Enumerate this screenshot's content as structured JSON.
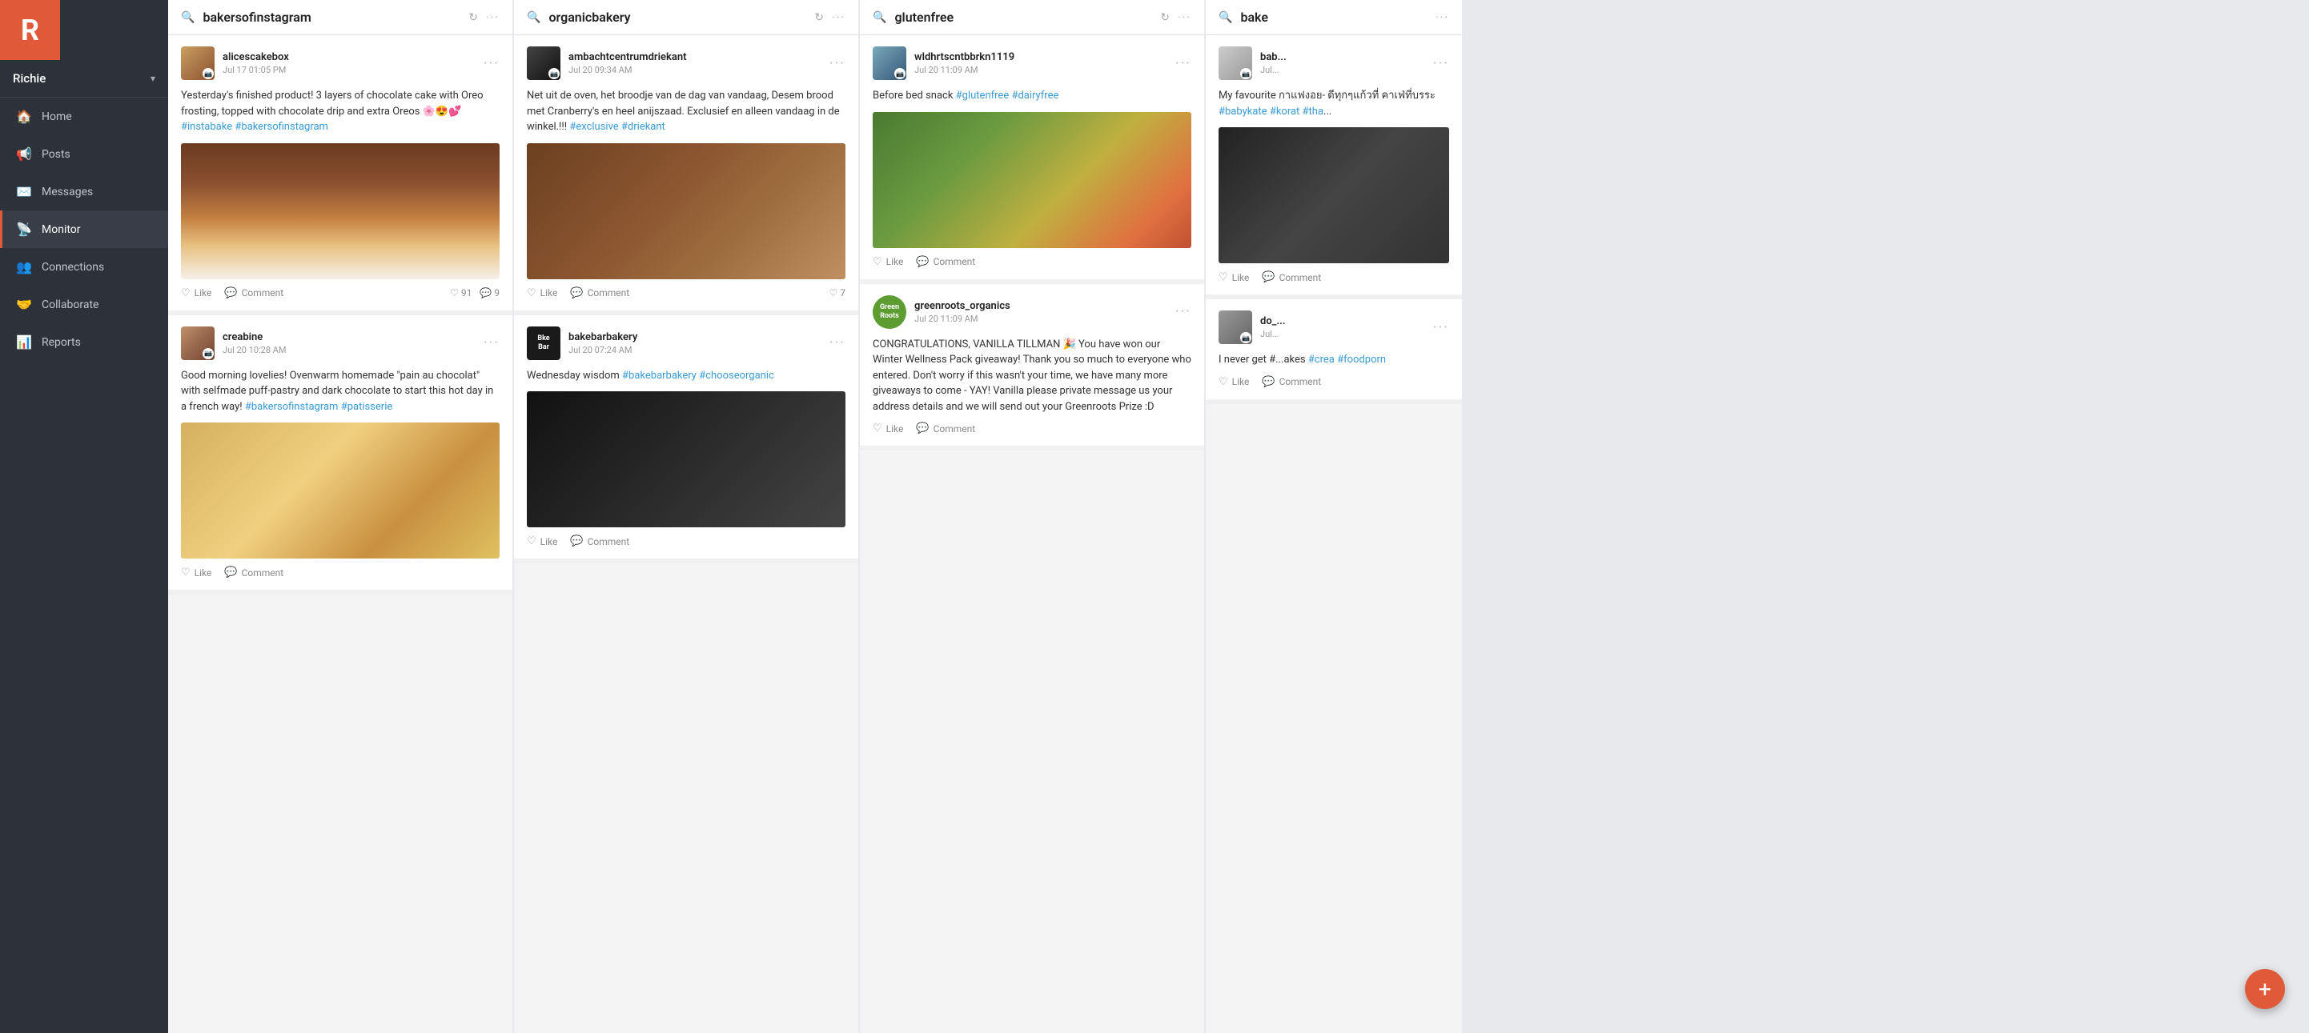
{
  "sidebar": {
    "logo_letter": "R",
    "username": "Richie",
    "chevron": "▾",
    "nav_items": [
      {
        "id": "home",
        "label": "Home",
        "icon": "🏠",
        "active": false
      },
      {
        "id": "posts",
        "label": "Posts",
        "icon": "📢",
        "active": false
      },
      {
        "id": "messages",
        "label": "Messages",
        "icon": "✉️",
        "active": false
      },
      {
        "id": "monitor",
        "label": "Monitor",
        "icon": "📡",
        "active": true
      },
      {
        "id": "connections",
        "label": "Connections",
        "icon": "👥",
        "active": false
      },
      {
        "id": "collaborate",
        "label": "Collaborate",
        "icon": "🤝",
        "active": false
      },
      {
        "id": "reports",
        "label": "Reports",
        "icon": "📊",
        "active": false
      }
    ]
  },
  "columns": [
    {
      "id": "bakersofinstagram",
      "title": "bakersofinstagram",
      "posts": [
        {
          "id": "alice1",
          "username": "alicescakebox",
          "time": "Jul 17 01:05 PM",
          "avatar_type": "alice",
          "text": "Yesterday's finished product! 3 layers of chocolate cake with Oreo frosting, topped with chocolate drip and extra Oreos 🌸😍💕 #instabake #bakersofinstagram",
          "hashtags": [
            "#instabake",
            "#bakersofinstagram"
          ],
          "has_image": true,
          "image_type": "cake",
          "like_count": 91,
          "comment_count": 9
        },
        {
          "id": "creabine1",
          "username": "creabine",
          "time": "Jul 20 10:28 AM",
          "avatar_type": "creabine",
          "text": "Good morning lovelies! Ovenwarm homemade \"pain au chocolat\" with selfmade puff-pastry and dark chocolate to start this hot day in a french way! #bakersofinstagram #patisserie",
          "hashtags": [
            "#bakersofinstagram",
            "#patisserie"
          ],
          "has_image": true,
          "image_type": "pastry",
          "like_count": null,
          "comment_count": null
        }
      ]
    },
    {
      "id": "organicbakery",
      "title": "organicbakery",
      "posts": [
        {
          "id": "ambacht1",
          "username": "ambachtcentrumdriekant",
          "time": "Jul 20 09:34 AM",
          "avatar_type": "ambacht",
          "text": "Net uit de oven, het broodje van de dag van vandaag, Desem brood met Cranberry's en heel anijszaad. Exclusief en alleen vandaag in de winkel.!!! #exclusive #driekant",
          "hashtags": [
            "#exclusive",
            "#driekant"
          ],
          "has_image": true,
          "image_type": "bread",
          "like_count": 7,
          "comment_count": null
        },
        {
          "id": "bakebar1",
          "username": "bakebarbakery",
          "time": "Jul 20 07:24 AM",
          "avatar_type": "bakebar",
          "avatar_text": "Bke\nBar",
          "text": "Wednesday wisdom #bakebarbakery #chooseorganic",
          "hashtags": [
            "#bakebarbakery",
            "#chooseorganic"
          ],
          "has_image": true,
          "image_type": "menu",
          "like_count": null,
          "comment_count": null
        }
      ]
    },
    {
      "id": "glutenfree",
      "title": "glutenfree",
      "posts": [
        {
          "id": "wldh1",
          "username": "wldhrtscntbbrkn1119",
          "time": "Jul 20 11:09 AM",
          "avatar_type": "wldh",
          "text": "Before bed snack #glutenfree #dairyfree",
          "hashtags": [
            "#glutenfree",
            "#dairyfree"
          ],
          "has_image": true,
          "image_type": "salad",
          "like_count": null,
          "comment_count": null
        },
        {
          "id": "greenroots1",
          "username": "greenroots_organics",
          "time": "Jul 20 11:09 AM",
          "avatar_type": "greenroots",
          "avatar_text": "Green\nRoots",
          "text": "CONGRATULATIONS, VANILLA TILLMAN 🎉\n\nYou have won our Winter Wellness Pack giveaway! Thank you so much to everyone who entered. Don't worry if this wasn't your time, we have many more giveaways to come - YAY!\nVanilla please private message us your address details and we will send out your Greenroots Prize :D",
          "hashtags": [],
          "has_image": false,
          "image_type": null,
          "like_count": null,
          "comment_count": null
        }
      ]
    },
    {
      "id": "bake-partial",
      "title": "bake",
      "posts": [
        {
          "id": "bab1",
          "username": "bab...",
          "time": "Jul...",
          "avatar_type": "bab",
          "text": "My favourite กาแฟงอย- ดีทุกๆแก้วที่ คาเฟ่ที่บรระ #babykate #korat #tha...",
          "hashtags": [
            "#babykate",
            "#korat",
            "#tha..."
          ],
          "has_image": true,
          "image_type": "dark",
          "like_count": null,
          "comment_count": null
        },
        {
          "id": "do1",
          "username": "do_...",
          "time": "Jul...",
          "avatar_type": "do",
          "text": "I never get #...akes #crea #foodporn",
          "hashtags": [
            "#crea",
            "#foodporn"
          ],
          "has_image": false,
          "image_type": null,
          "like_count": null,
          "comment_count": null
        }
      ]
    }
  ],
  "fab": "+",
  "icons": {
    "search": "🔍",
    "refresh": "↻",
    "more": "···",
    "like": "♡",
    "comment": "💬",
    "instagram": "📷"
  }
}
